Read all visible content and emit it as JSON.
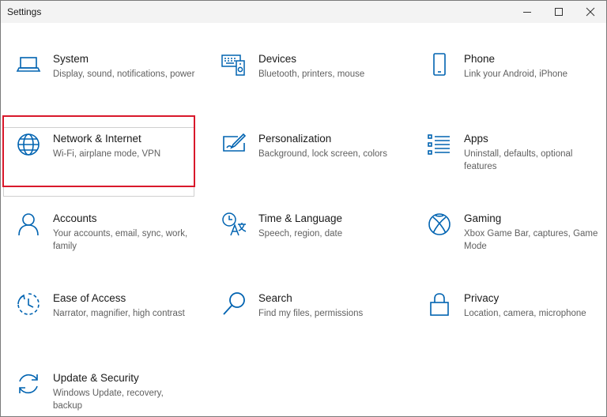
{
  "window": {
    "title": "Settings",
    "controls": [
      "minimize",
      "maximize",
      "close"
    ]
  },
  "colors": {
    "accent": "#0063b1",
    "highlight": "#d9182b",
    "text": "#1a1a1a",
    "subtext": "#606060"
  },
  "tiles": [
    {
      "name": "System",
      "desc": "Display, sound, notifications, power",
      "icon": "laptop-icon"
    },
    {
      "name": "Devices",
      "desc": "Bluetooth, printers, mouse",
      "icon": "devices-icon"
    },
    {
      "name": "Phone",
      "desc": "Link your Android, iPhone",
      "icon": "phone-icon"
    },
    {
      "name": "Network & Internet",
      "desc": "Wi-Fi, airplane mode, VPN",
      "icon": "globe-icon",
      "selected": true
    },
    {
      "name": "Personalization",
      "desc": "Background, lock screen, colors",
      "icon": "paint-icon"
    },
    {
      "name": "Apps",
      "desc": "Uninstall, defaults, optional features",
      "icon": "apps-list-icon"
    },
    {
      "name": "Accounts",
      "desc": "Your accounts, email, sync, work, family",
      "icon": "person-icon"
    },
    {
      "name": "Time & Language",
      "desc": "Speech, region, date",
      "icon": "time-language-icon"
    },
    {
      "name": "Gaming",
      "desc": "Xbox Game Bar, captures, Game Mode",
      "icon": "xbox-icon"
    },
    {
      "name": "Ease of Access",
      "desc": "Narrator, magnifier, high contrast",
      "icon": "ease-of-access-icon"
    },
    {
      "name": "Search",
      "desc": "Find my files, permissions",
      "icon": "search-icon"
    },
    {
      "name": "Privacy",
      "desc": "Location, camera, microphone",
      "icon": "lock-icon"
    },
    {
      "name": "Update & Security",
      "desc": "Windows Update, recovery, backup",
      "icon": "sync-icon"
    }
  ]
}
